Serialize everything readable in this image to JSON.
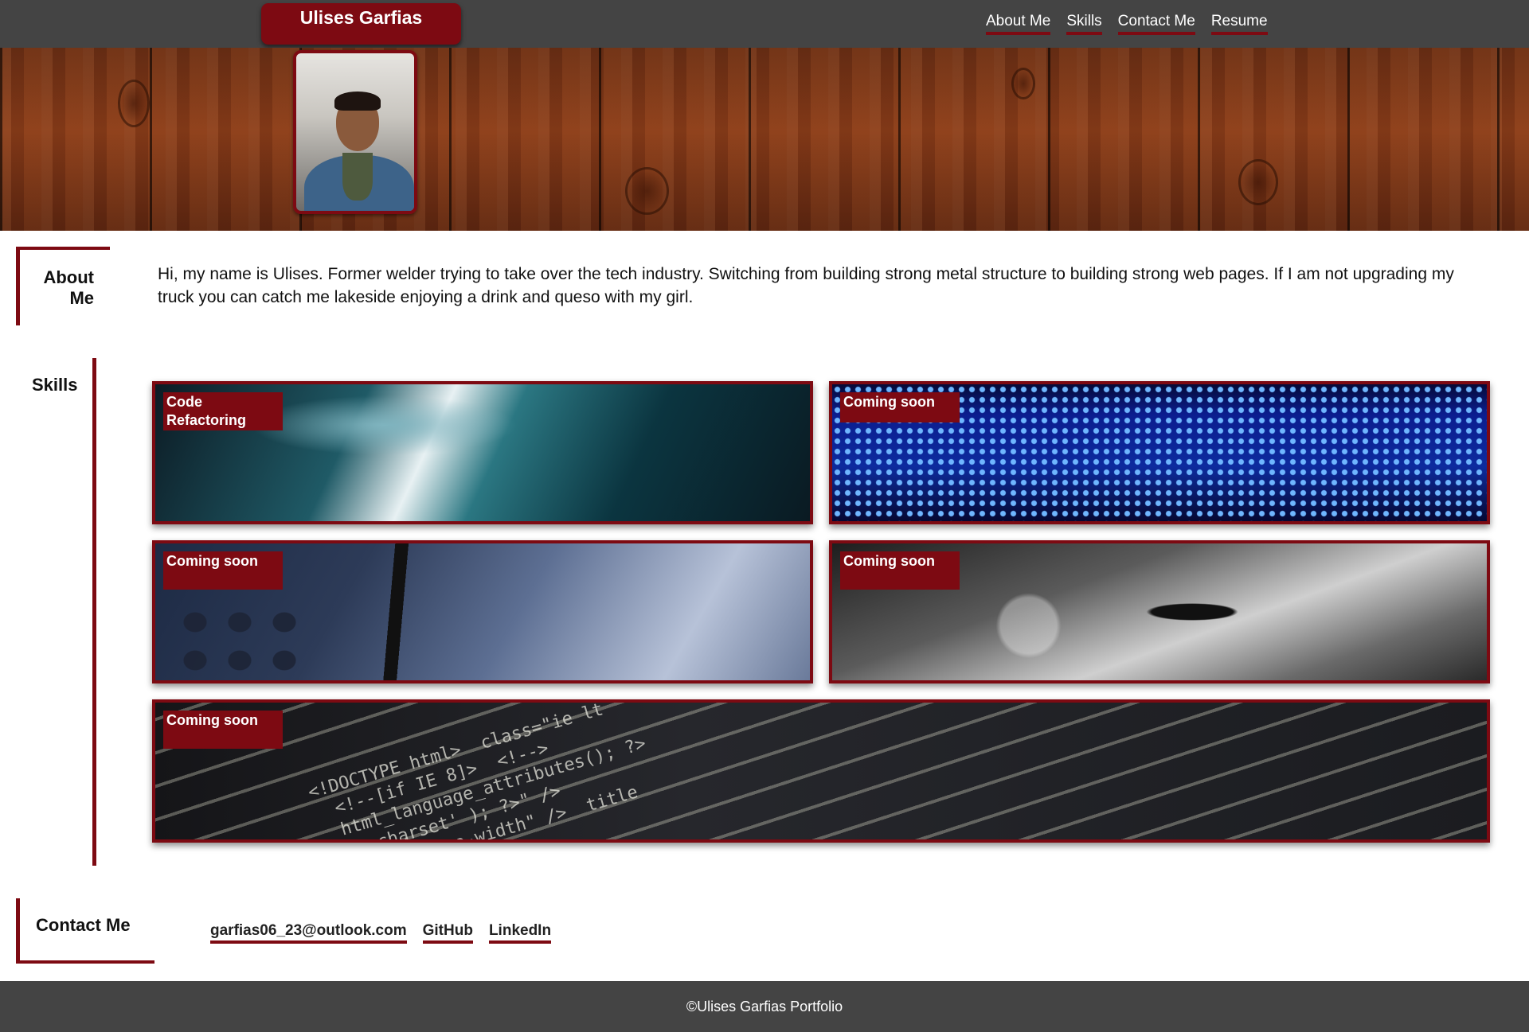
{
  "header": {
    "brand": "Ulises Garfias",
    "nav": [
      "About Me",
      "Skills",
      "Contact Me",
      "Resume"
    ]
  },
  "about": {
    "title_line1": "About",
    "title_line2": "Me",
    "text": "Hi, my name is Ulises. Former welder trying to take over the tech industry. Switching from building strong metal structure to building strong web pages. If I am not upgrading my truck you can catch me lakeside enjoying a drink and queso with my girl."
  },
  "skills": {
    "title": "Skills",
    "cards": [
      {
        "label": "Code Refactoring"
      },
      {
        "label": "Coming soon"
      },
      {
        "label": "Coming soon"
      },
      {
        "label": "Coming soon"
      },
      {
        "label": "Coming soon"
      }
    ],
    "code_snippet": "<!DOCTYPE html>  class=\"ie lt\n  <!--[if IE 8]>  <!-->\n  html_language_attributes(); ?>\n     charset' ); ?>\" />\n       device-width\" />  title"
  },
  "contact": {
    "title": "Contact Me",
    "links": [
      "garfias06_23@outlook.com",
      "GitHub",
      "LinkedIn"
    ]
  },
  "footer": {
    "text": "©Ulises Garfias Portfolio"
  },
  "colors": {
    "accent": "#7d0a12",
    "bar": "#444444"
  }
}
